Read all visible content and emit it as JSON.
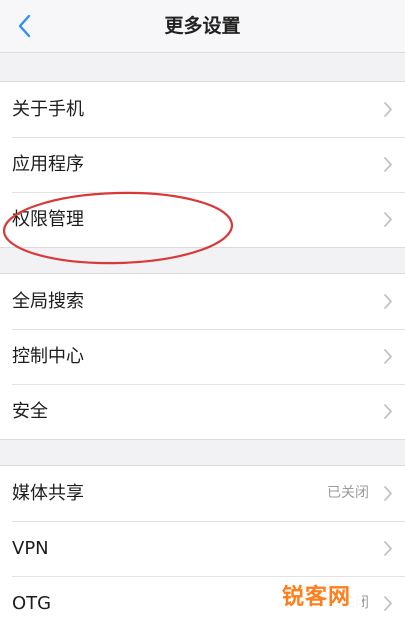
{
  "header": {
    "title": "更多设置",
    "back_icon": "chevron-left-icon",
    "accent_color": "#2f8ff7"
  },
  "groups": [
    {
      "items": [
        {
          "label": "关于手机",
          "value": ""
        },
        {
          "label": "应用程序",
          "value": ""
        },
        {
          "label": "权限管理",
          "value": ""
        }
      ]
    },
    {
      "items": [
        {
          "label": "全局搜索",
          "value": ""
        },
        {
          "label": "控制中心",
          "value": ""
        },
        {
          "label": "安全",
          "value": ""
        }
      ]
    },
    {
      "items": [
        {
          "label": "媒体共享",
          "value": "已关闭"
        },
        {
          "label": "VPN",
          "value": ""
        },
        {
          "label": "OTG",
          "value": "已关闭"
        }
      ]
    }
  ],
  "annotation": {
    "shape": "ellipse",
    "color": "#d83a3a",
    "target": "权限管理"
  },
  "watermark": {
    "text": "锐客网",
    "color": "#ff7d1a"
  }
}
